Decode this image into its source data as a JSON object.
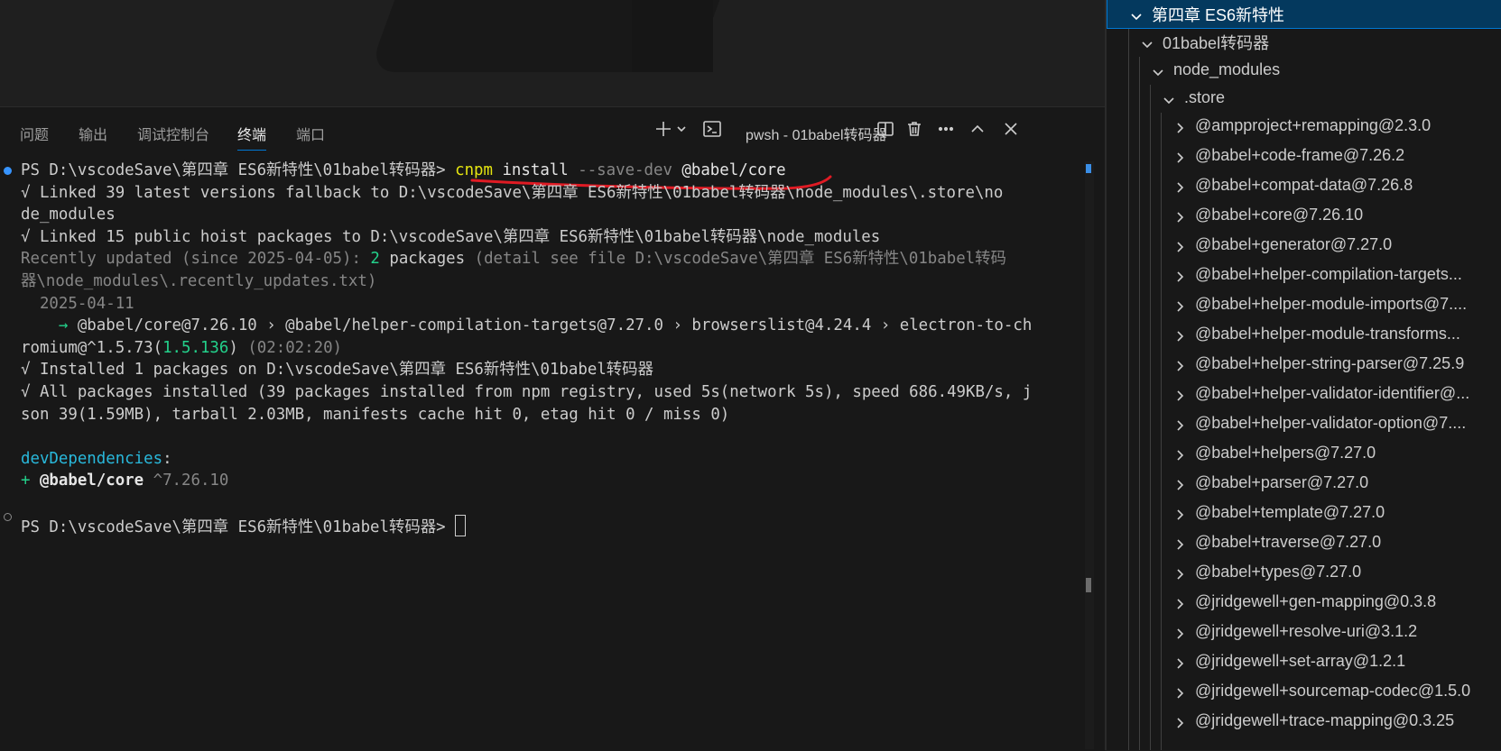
{
  "panel": {
    "tabs": [
      "问题",
      "输出",
      "调试控制台",
      "终端",
      "端口"
    ],
    "active_tab": "终端",
    "terminal_name": "pwsh - 01babel转码器"
  },
  "terminal": {
    "prompt": "PS D:\\vscodeSave\\第四章 ES6新特性\\01babel转码器> ",
    "cmd_name": "cnpm",
    "cmd_sub": " install ",
    "cmd_flag": "--save-dev",
    "cmd_pkg": " @babel/core",
    "line2": "√ Linked 39 latest versions fallback to D:\\vscodeSave\\第四章 ES6新特性\\01babel转码器\\node_modules\\.store\\no",
    "line3": "de_modules",
    "line4": "√ Linked 15 public hoist packages to D:\\vscodeSave\\第四章 ES6新特性\\01babel转码器\\node_modules",
    "line5_a": "Recently updated (since 2025-04-05): ",
    "line5_b": "2",
    "line5_c": " packages",
    "line5_d": " (detail see file D:\\vscodeSave\\第四章 ES6新特性\\01babel转码",
    "line6": "器\\node_modules\\.recently_updates.txt)",
    "line7": "  2025-04-11",
    "line8_arrow": "    → ",
    "line8_text": "@babel/core@7.26.10 › @babel/helper-compilation-targets@7.27.0 › browserslist@4.24.4 › electron-to-ch",
    "line9_a": "romium@^1.5.73(",
    "line9_b": "1.5.136",
    "line9_c": ")",
    "line9_d": " (02:02:20)",
    "line10": "√ Installed 1 packages on D:\\vscodeSave\\第四章 ES6新特性\\01babel转码器",
    "line11": "√ All packages installed (39 packages installed from npm registry, used 5s(network 5s), speed 686.49KB/s, j",
    "line12": "son 39(1.59MB), tarball 2.03MB, manifests cache hit 0, etag hit 0 / miss 0)",
    "devdeps_label": "devDependencies",
    "devdeps_colon": ":",
    "dep_plus": "+ ",
    "dep_name": "@babel/core",
    "dep_version": " ^7.26.10",
    "prompt2": "PS D:\\vscodeSave\\第四章 ES6新特性\\01babel转码器> "
  },
  "explorer": {
    "root": "第四章 ES6新特性",
    "folder1": "01babel转码器",
    "folder2": "node_modules",
    "folder3": ".store",
    "items": [
      "@ampproject+remapping@2.3.0",
      "@babel+code-frame@7.26.2",
      "@babel+compat-data@7.26.8",
      "@babel+core@7.26.10",
      "@babel+generator@7.27.0",
      "@babel+helper-compilation-targets...",
      "@babel+helper-module-imports@7....",
      "@babel+helper-module-transforms...",
      "@babel+helper-string-parser@7.25.9",
      "@babel+helper-validator-identifier@...",
      "@babel+helper-validator-option@7....",
      "@babel+helpers@7.27.0",
      "@babel+parser@7.27.0",
      "@babel+template@7.27.0",
      "@babel+traverse@7.27.0",
      "@babel+types@7.27.0",
      "@jridgewell+gen-mapping@0.3.8",
      "@jridgewell+resolve-uri@3.1.2",
      "@jridgewell+set-array@1.2.1",
      "@jridgewell+sourcemap-codec@1.5.0",
      "@jridgewell+trace-mapping@0.3.25"
    ]
  },
  "colors": {
    "accent": "#0078d4",
    "annotation": "#e01b24"
  }
}
